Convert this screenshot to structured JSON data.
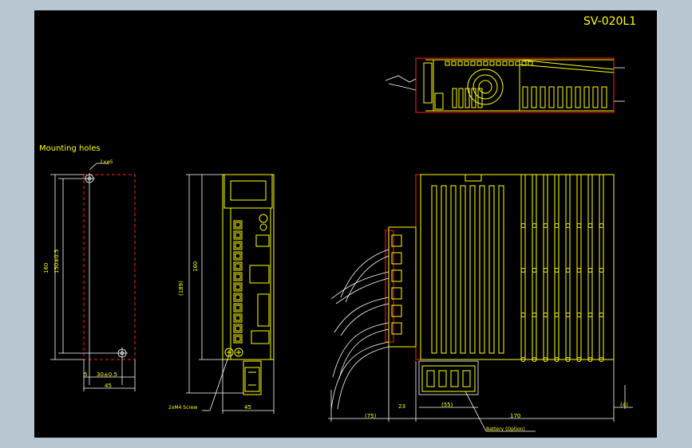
{
  "drawing": {
    "title": "SV-020L1",
    "mounting_label": "Mounting holes",
    "dims": {
      "hole": "2×φ5",
      "d160": "160",
      "d150": "150±0.5",
      "d5": "5",
      "d30": "30±0.5",
      "d45a": "45",
      "d189": "(189)",
      "d160b": "160",
      "screw": "2xM4 Screw",
      "d45b": "45",
      "d75": "(75)",
      "d23": "23",
      "d55": "(55)",
      "d170": "170",
      "d4": "(4)",
      "battery": "Battery (Option)"
    }
  }
}
